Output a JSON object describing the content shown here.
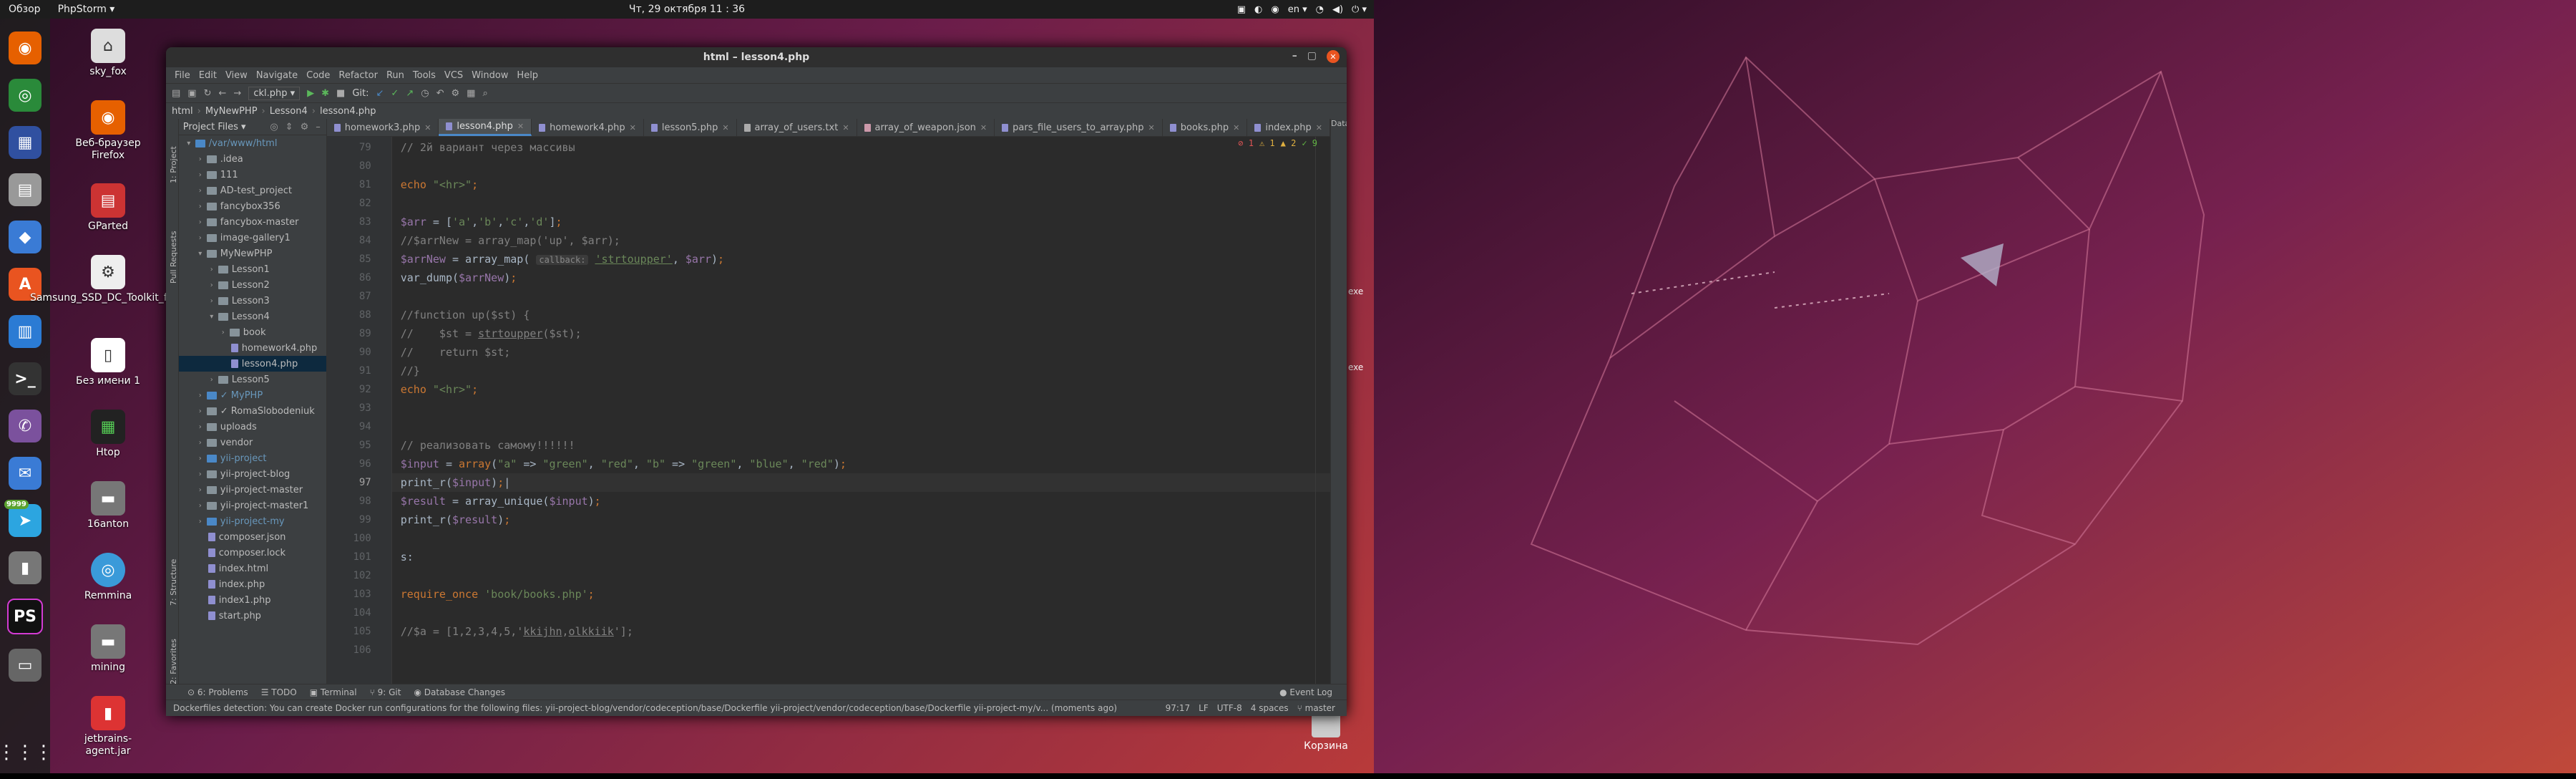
{
  "topbar": {
    "activities": "Обзор",
    "app": "PhpStorm ▾",
    "clock": "Чт, 29 октября  11 : 36",
    "lang": "en ▾",
    "power": "⏻ ▾"
  },
  "dock": {
    "apps_icon": "⋮⋮⋮",
    "items": [
      "firefox-icon",
      "chrome-icon",
      "calculator-icon",
      "files-icon",
      "software-icon",
      "appcenter-icon",
      "libreoffice-icon",
      "terminal-icon",
      "viber-icon",
      "messages-icon",
      "telegram-icon",
      "usb-icon",
      "phpstorm-icon",
      "drive-icon"
    ],
    "telegram_badge": "9999"
  },
  "desktop": {
    "icons": [
      {
        "label": "sky_fox"
      },
      {
        "label": "Веб-браузер Firefox"
      },
      {
        "label": "GParted"
      },
      {
        "label": "Samsung_SSD_DC_Toolkit_for..."
      },
      {
        "label": "Без имени 1"
      },
      {
        "label": "Htop"
      },
      {
        "label": "16anton"
      },
      {
        "label": "Remmina"
      },
      {
        "label": "mining"
      },
      {
        "label": "jetbrains-agent.jar"
      }
    ],
    "trash": "Корзина",
    "partial_1": "exe",
    "partial_2": "exe"
  },
  "ide": {
    "title": "html – lesson4.php",
    "menu": [
      "File",
      "Edit",
      "View",
      "Navigate",
      "Code",
      "Refactor",
      "Run",
      "Tools",
      "VCS",
      "Window",
      "Help"
    ],
    "run_config": "ckl.php ▾",
    "git_label": "Git:",
    "breadcrumbs": [
      "html",
      "MyNewPHP",
      "Lesson4",
      "lesson4.php"
    ],
    "project_label": "Project Files ▾",
    "side_labels": {
      "project": "1: Project",
      "pull": "Pull Requests",
      "structure": "7: Structure",
      "favorites": "2: Favorites",
      "database": "Database"
    },
    "tree": [
      {
        "depth": 0,
        "type": "folder",
        "open": true,
        "label": "/var/www/html",
        "blue": true
      },
      {
        "depth": 1,
        "type": "folder",
        "open": false,
        "label": ".idea"
      },
      {
        "depth": 1,
        "type": "folder",
        "open": false,
        "label": "111"
      },
      {
        "depth": 1,
        "type": "folder",
        "open": false,
        "label": "AD-test_project"
      },
      {
        "depth": 1,
        "type": "folder",
        "open": false,
        "label": "fancybox356"
      },
      {
        "depth": 1,
        "type": "folder",
        "open": false,
        "label": "fancybox-master"
      },
      {
        "depth": 1,
        "type": "folder",
        "open": false,
        "label": "image-gallery1"
      },
      {
        "depth": 1,
        "type": "folder",
        "open": true,
        "label": "MyNewPHP"
      },
      {
        "depth": 2,
        "type": "folder",
        "open": false,
        "label": "Lesson1"
      },
      {
        "depth": 2,
        "type": "folder",
        "open": false,
        "label": "Lesson2"
      },
      {
        "depth": 2,
        "type": "folder",
        "open": false,
        "label": "Lesson3"
      },
      {
        "depth": 2,
        "type": "folder",
        "open": true,
        "label": "Lesson4"
      },
      {
        "depth": 3,
        "type": "folder",
        "open": false,
        "label": "book"
      },
      {
        "depth": 3,
        "type": "file",
        "label": "homework4.php"
      },
      {
        "depth": 3,
        "type": "file",
        "label": "lesson4.php"
      },
      {
        "depth": 2,
        "type": "folder",
        "open": false,
        "label": "Lesson5"
      },
      {
        "depth": 1,
        "type": "folder",
        "open": false,
        "label": "✓ MyPHP",
        "blue": true
      },
      {
        "depth": 1,
        "type": "folder",
        "open": false,
        "label": "✓ RomaSlobodeniuk"
      },
      {
        "depth": 1,
        "type": "folder",
        "open": false,
        "label": "uploads"
      },
      {
        "depth": 1,
        "type": "folder",
        "open": false,
        "label": "vendor"
      },
      {
        "depth": 1,
        "type": "folder",
        "open": false,
        "label": "yii-project",
        "blue": true
      },
      {
        "depth": 1,
        "type": "folder",
        "open": false,
        "label": "yii-project-blog"
      },
      {
        "depth": 1,
        "type": "folder",
        "open": false,
        "label": "yii-project-master"
      },
      {
        "depth": 1,
        "type": "folder",
        "open": false,
        "label": "yii-project-master1"
      },
      {
        "depth": 1,
        "type": "folder",
        "open": false,
        "label": "yii-project-my",
        "blue": true
      },
      {
        "depth": 1,
        "type": "file",
        "label": "composer.json"
      },
      {
        "depth": 1,
        "type": "file",
        "label": "composer.lock"
      },
      {
        "depth": 1,
        "type": "file",
        "label": "index.html"
      },
      {
        "depth": 1,
        "type": "file",
        "label": "index.php"
      },
      {
        "depth": 1,
        "type": "file",
        "label": "index1.php"
      },
      {
        "depth": 1,
        "type": "file",
        "label": "start.php"
      }
    ],
    "tabs": [
      {
        "label": "homework3.php",
        "active": false
      },
      {
        "label": "lesson4.php",
        "active": true
      },
      {
        "label": "homework4.php",
        "active": false
      },
      {
        "label": "lesson5.php",
        "active": false
      },
      {
        "label": "array_of_users.txt",
        "active": false
      },
      {
        "label": "array_of_weapon.json",
        "active": false
      },
      {
        "label": "pars_file_users_to_array.php",
        "active": false
      },
      {
        "label": "books.php",
        "active": false
      },
      {
        "label": "index.php",
        "active": false
      }
    ],
    "inspections": {
      "errors": "⊘ 1",
      "warnings": "⚠ 1",
      "weak": "▲ 2",
      "typos": "✓ 9"
    },
    "line_numbers": [
      "79",
      "80",
      "81",
      "82",
      "83",
      "84",
      "85",
      "86",
      "87",
      "88",
      "89",
      "90",
      "91",
      "92",
      "93",
      "94",
      "95",
      "96",
      "97",
      "98",
      "99",
      "100",
      "101",
      "102",
      "103",
      "104",
      "105",
      "106"
    ],
    "bottom_tabs": [
      "⊙ 6: Problems",
      "☰ TODO",
      "▣ Terminal",
      "⑂ 9: Git",
      "◉ Database Changes"
    ],
    "event_log": "● Event Log",
    "status_msg": "Dockerfiles detection: You can create Docker run configurations for the following files: yii-project-blog/vendor/codeception/base/Dockerfile yii-project/vendor/codeception/base/Dockerfile yii-project-my/v... (moments ago)",
    "status_right": [
      "97:17",
      "LF",
      "UTF-8",
      "4 spaces",
      "⑂ master"
    ]
  }
}
